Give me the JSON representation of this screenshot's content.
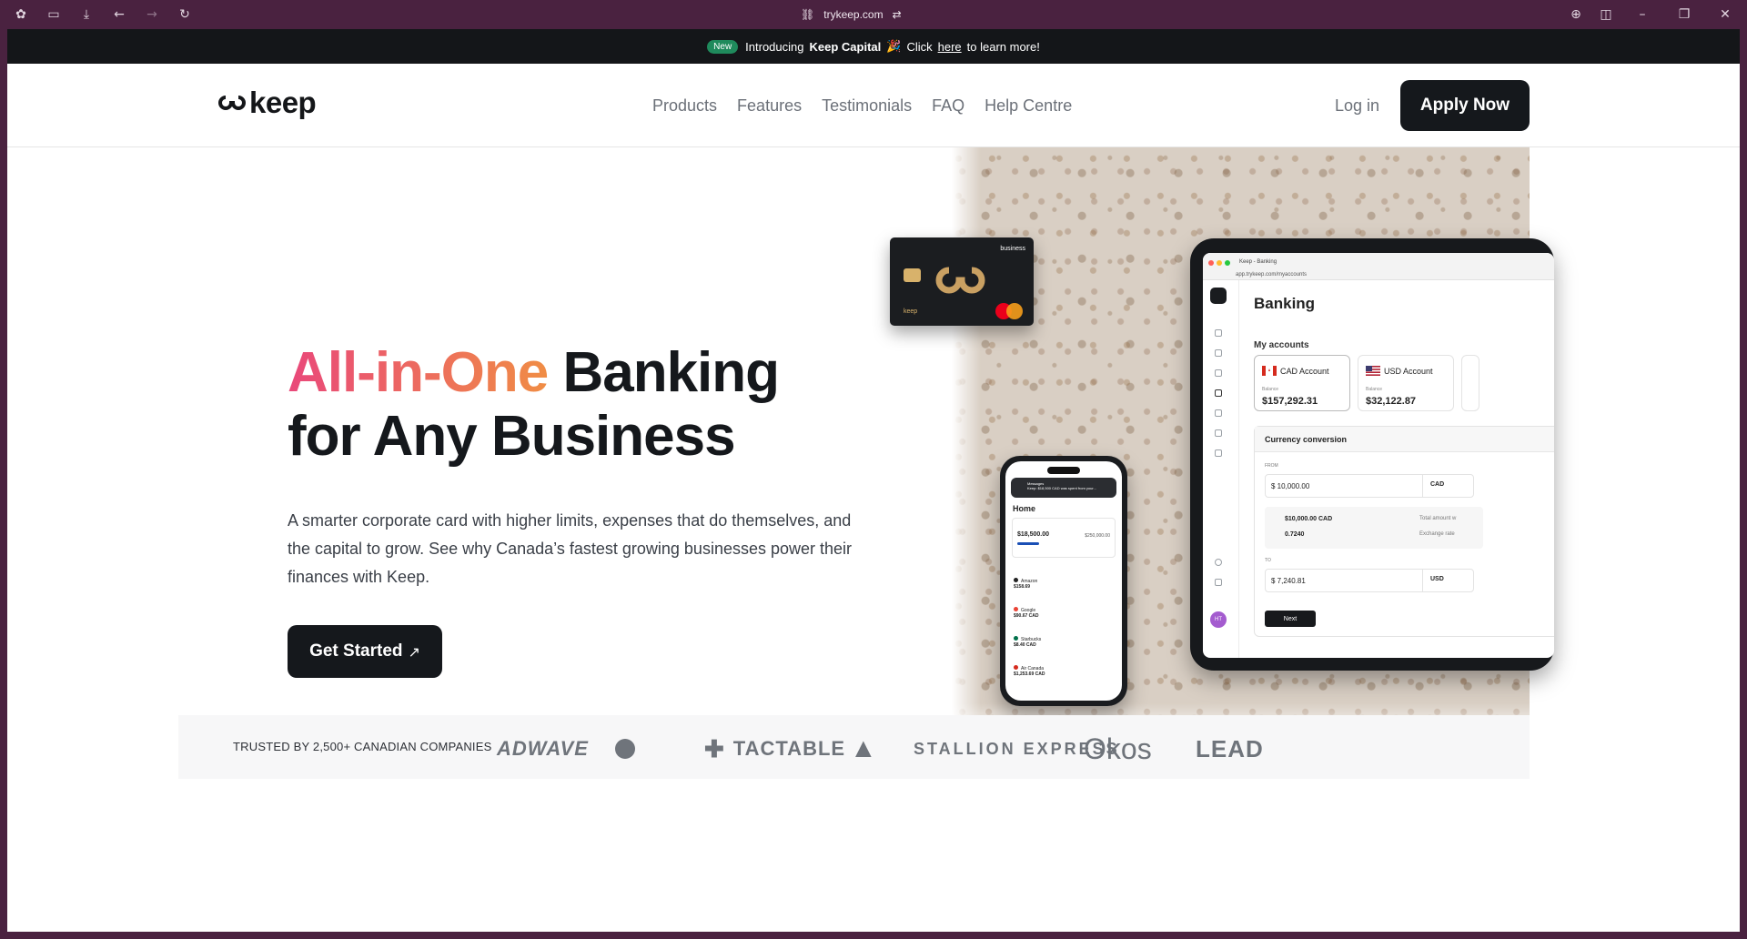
{
  "browser": {
    "url": "trykeep.com"
  },
  "announcement": {
    "badge": "New",
    "pre": "Introducing",
    "product": "Keep Capital",
    "emoji": "🎉",
    "click": "Click",
    "link": "here",
    "post": "to learn more!"
  },
  "nav": {
    "logo": "keep",
    "menu": [
      "Products",
      "Features",
      "Testimonials",
      "FAQ",
      "Help Centre"
    ],
    "login": "Log in",
    "apply": "Apply Now"
  },
  "hero": {
    "title_highlight": "All-in-One",
    "title_rest_line1": "Banking",
    "title_line2": "for Any Business",
    "subtitle": "A smarter corporate card with higher limits, expenses that do themselves, and the capital to grow. See why Canada’s fastest growing businesses power their finances with Keep.",
    "cta": "Get Started",
    "cta_icon": "arrow-up-right-icon"
  },
  "card": {
    "tier": "business",
    "brand": "keep"
  },
  "phone": {
    "notification_title": "Messages",
    "notification_text": "Keep: $18,500 CAD was spent from your...",
    "home": "Home",
    "balance": "$18,500.00",
    "limit": "$250,000.00",
    "transactions": [
      {
        "merchant": "Amazon",
        "amount": "$158.69",
        "color": "#222222"
      },
      {
        "merchant": "Google",
        "amount": "$90.67 CAD",
        "color": "#ea4335"
      },
      {
        "merchant": "Starbucks",
        "amount": "$8.40 CAD",
        "color": "#00704a"
      },
      {
        "merchant": "Air Canada",
        "amount": "$1,253.69 CAD",
        "color": "#d52b1e"
      }
    ]
  },
  "tablet": {
    "tab_title": "Keep - Banking",
    "address": "app.trykeep.com/myaccounts",
    "page_title": "Banking",
    "my_accounts": "My accounts",
    "accounts": [
      {
        "name": "CAD Account",
        "balance_label": "Balance",
        "balance": "$157,292.31"
      },
      {
        "name": "USD Account",
        "balance_label": "Balance",
        "balance": "$32,122.87"
      }
    ],
    "conversion": {
      "title": "Currency conversion",
      "from_label": "FROM",
      "from_value": "$ 10,000.00",
      "from_currency": "CAD",
      "total_value": "$10,000.00 CAD",
      "total_label": "Total amount w",
      "rate_value": "0.7240",
      "rate_label": "Exchange rate",
      "to_label": "TO",
      "to_value": "$ 7,240.81",
      "to_currency": "USD",
      "next": "Next"
    },
    "avatar": "HT"
  },
  "trusted": {
    "label": "TRUSTED BY 2,500+ CANADIAN COMPANIES",
    "logos": [
      "ADWAVE",
      "TACTABLE",
      "STALLION EXPRESS",
      "Okos",
      "LEAD"
    ]
  },
  "colors": {
    "accent_dark": "#15181c",
    "gradient_start": "#e9487a",
    "gradient_end": "#f08d45",
    "badge_green": "#1f8a5c"
  }
}
